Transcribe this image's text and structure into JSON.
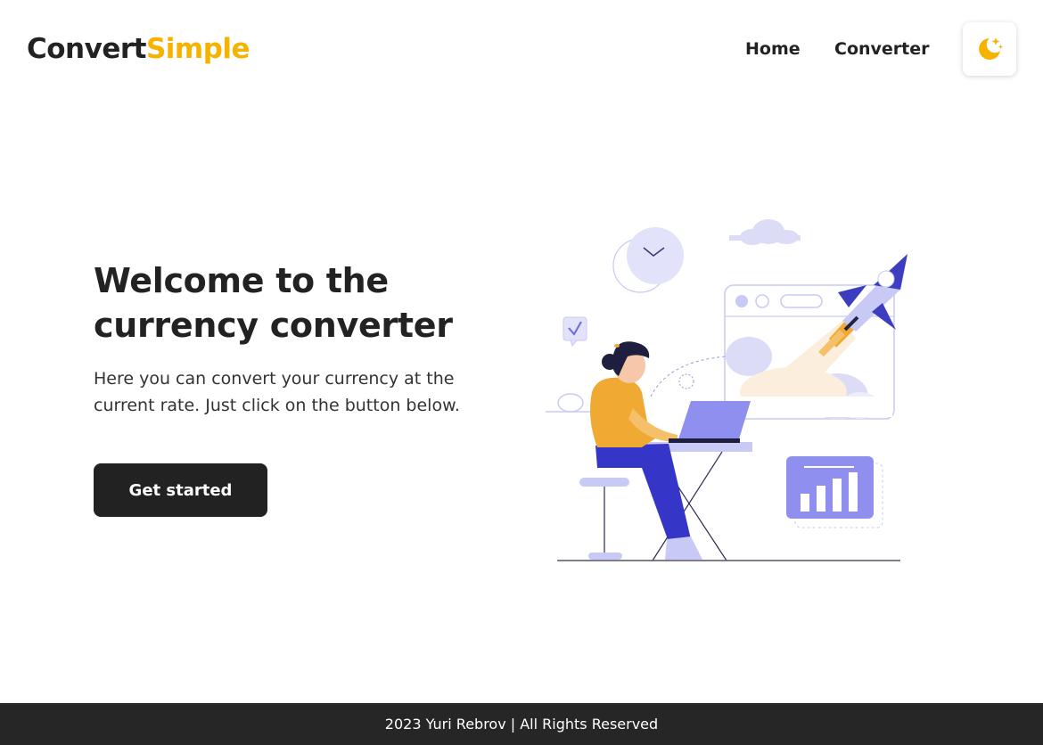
{
  "header": {
    "logo_part1": "Convert",
    "logo_part2": "Simple",
    "nav": {
      "home": "Home",
      "converter": "Converter"
    },
    "theme_toggle_icon": "moon-stars-icon"
  },
  "hero": {
    "title": "Welcome to the currency converter",
    "text": "Here you can convert your currency at the current rate. Just click on the button below.",
    "cta_label": "Get started"
  },
  "footer": {
    "text": "2023 Yuri Rebrov | All Rights Reserved"
  },
  "colors": {
    "accent": "#f5b300",
    "dark": "#222222",
    "illustration_primary": "#3d3dbf",
    "illustration_light": "#c9c9f5",
    "illustration_orange": "#f0a933"
  }
}
